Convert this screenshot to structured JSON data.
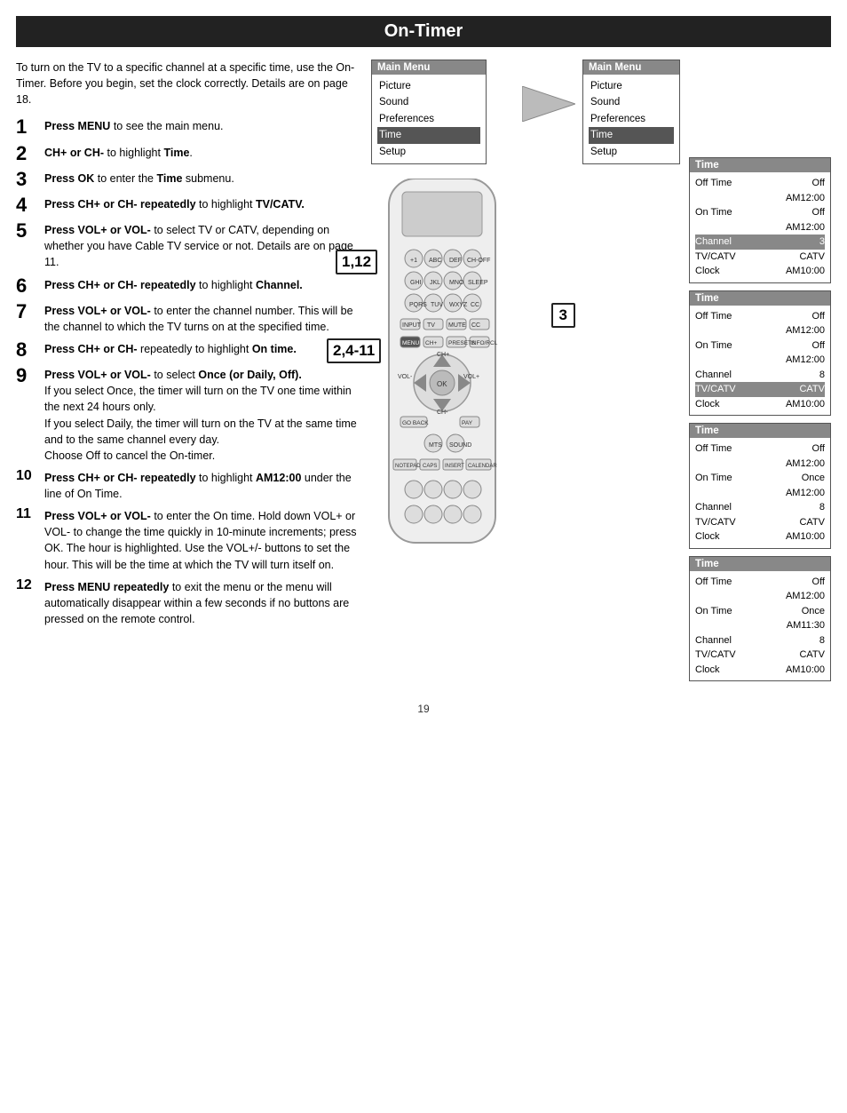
{
  "header": {
    "title": "On-Timer"
  },
  "intro": "To turn on the TV to a specific channel at a specific time, use the On-Timer. Before you begin, set the clock correctly. Details are on page 18.",
  "steps": [
    {
      "num": "1",
      "text": "<b>Press MENU</b> to see the main menu.",
      "size": "large"
    },
    {
      "num": "2",
      "text": "<b>CH+ or CH-</b> to highlight <b>Time</b>.",
      "size": "large"
    },
    {
      "num": "3",
      "text": "<b>Press OK</b> to enter the <b>Time</b> submenu.",
      "size": "large"
    },
    {
      "num": "4",
      "text": "<b>Press CH+ or CH- repeatedly</b> to highlight <b>TV/CATV.</b>",
      "size": "large"
    },
    {
      "num": "5",
      "text": "<b>Press VOL+ or VOL-</b> to select TV or CATV, depending on whether you have Cable TV service or not. Details are on page 11.",
      "size": "large"
    },
    {
      "num": "6",
      "text": "<b>Press CH+ or CH- repeatedly</b> to highlight <b>Channel.</b>",
      "size": "large"
    },
    {
      "num": "7",
      "text": "<b>Press VOL+ or VOL-</b> to enter the channel number. This will be the channel to which the TV turns on at the specified time.",
      "size": "large"
    },
    {
      "num": "8",
      "text": "<b>Press CH+ or CH-</b> repeatedly to highlight <b>On time.</b>",
      "size": "large"
    },
    {
      "num": "9",
      "text": "<b>Press VOL+ or VOL-</b> to select <b>Once (or Daily, Off).</b><br>If you select Once, the timer will turn on the TV one time within the next 24 hours only.<br>If you select Daily, the timer will turn on the TV at the same time and to the same channel every day.<br>Choose Off to cancel the On-timer.",
      "size": "large"
    },
    {
      "num": "10",
      "text": "<b>Press CH+ or CH- repeatedly</b> to highlight <b>AM12:00</b> under the line of On Time.",
      "size": "small"
    },
    {
      "num": "11",
      "text": "<b>Press VOL+ or VOL-</b> to enter the On time. Hold down VOL+ or VOL- to change the time quickly in 10-minute increments; press OK. The hour is highlighted. Use the VOL+/- buttons to set the hour. This will be the time at which the TV will turn itself on.",
      "size": "small"
    },
    {
      "num": "12",
      "text": "<b>Press MENU repeatedly</b> to exit the menu or the menu will automatically disappear within a few seconds if no buttons are pressed on the remote control.",
      "size": "small"
    }
  ],
  "mainMenu1": {
    "title": "Main Menu",
    "items": [
      "Picture",
      "Sound",
      "Preferences",
      "Time",
      "Setup"
    ]
  },
  "mainMenu2": {
    "title": "Main Menu",
    "items": [
      "Picture",
      "Sound",
      "Preferences",
      "Time",
      "Setup"
    ],
    "highlighted": "Time"
  },
  "timeMenus": [
    {
      "title": "Time",
      "rows": [
        {
          "label": "Off Time",
          "value": "Off"
        },
        {
          "label": "",
          "value": "AM12:00"
        },
        {
          "label": "On Time",
          "value": "Off"
        },
        {
          "label": "",
          "value": "AM12:00"
        },
        {
          "label": "Channel",
          "value": "3",
          "highlighted": true
        },
        {
          "label": "TV/CATV",
          "value": "CATV"
        },
        {
          "label": "Clock",
          "value": "AM10:00"
        }
      ],
      "label": "3"
    },
    {
      "title": "Time",
      "rows": [
        {
          "label": "Off Time",
          "value": "Off"
        },
        {
          "label": "",
          "value": "AM12:00"
        },
        {
          "label": "On Time",
          "value": "Off"
        },
        {
          "label": "",
          "value": "AM12:00"
        },
        {
          "label": "Channel",
          "value": "8"
        },
        {
          "label": "TV/CATV",
          "value": "CATV",
          "highlighted": true
        },
        {
          "label": "Clock",
          "value": "AM10:00"
        }
      ]
    },
    {
      "title": "Time",
      "rows": [
        {
          "label": "Off Time",
          "value": "Off"
        },
        {
          "label": "",
          "value": "AM12:00"
        },
        {
          "label": "On Time",
          "value": "Once"
        },
        {
          "label": "",
          "value": "AM12:00"
        },
        {
          "label": "Channel",
          "value": "8"
        },
        {
          "label": "TV/CATV",
          "value": "CATV"
        },
        {
          "label": "Clock",
          "value": "AM10:00"
        }
      ]
    },
    {
      "title": "Time",
      "rows": [
        {
          "label": "Off Time",
          "value": "Off"
        },
        {
          "label": "",
          "value": "AM12:00"
        },
        {
          "label": "On Time",
          "value": "Once"
        },
        {
          "label": "",
          "value": "AM11:30"
        },
        {
          "label": "Channel",
          "value": "8"
        },
        {
          "label": "TV/CATV",
          "value": "CATV"
        },
        {
          "label": "Clock",
          "value": "AM10:00"
        }
      ]
    }
  ],
  "stepLabels": {
    "label1": "1,12",
    "label2": "2,4-11",
    "label3": "3"
  },
  "pageNumber": "19"
}
